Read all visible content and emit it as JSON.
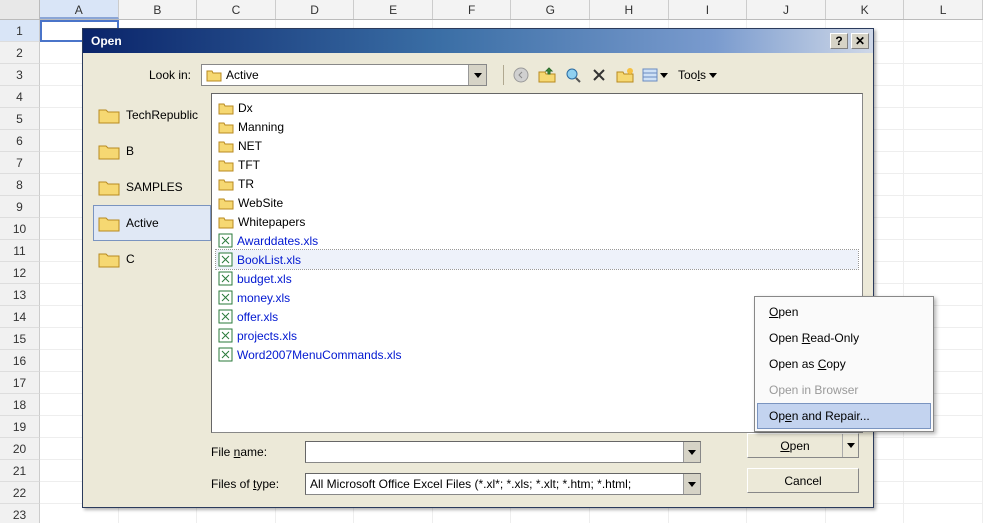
{
  "columns": [
    "A",
    "B",
    "C",
    "D",
    "E",
    "F",
    "G",
    "H",
    "I",
    "J",
    "K",
    "L"
  ],
  "row_count": 23,
  "selected_cell": {
    "row": 1,
    "col": "A"
  },
  "dialog": {
    "title": "Open",
    "lookin_label": "Look in:",
    "lookin_value": "Active",
    "tools_label": "Tools",
    "places": [
      {
        "label": "TechRepublic",
        "sel": false
      },
      {
        "label": "B",
        "sel": false
      },
      {
        "label": "SAMPLES",
        "sel": false
      },
      {
        "label": "Active",
        "sel": true
      },
      {
        "label": "C",
        "sel": false
      }
    ],
    "files": [
      {
        "name": "Dx",
        "type": "folder"
      },
      {
        "name": "Manning",
        "type": "folder"
      },
      {
        "name": "NET",
        "type": "folder"
      },
      {
        "name": "TFT",
        "type": "folder"
      },
      {
        "name": "TR",
        "type": "folder"
      },
      {
        "name": "WebSite",
        "type": "folder"
      },
      {
        "name": "Whitepapers",
        "type": "folder"
      },
      {
        "name": "Awarddates.xls",
        "type": "xls"
      },
      {
        "name": "BookList.xls",
        "type": "xls",
        "sel": true
      },
      {
        "name": "budget.xls",
        "type": "xls"
      },
      {
        "name": "money.xls",
        "type": "xls"
      },
      {
        "name": "offer.xls",
        "type": "xls"
      },
      {
        "name": "projects.xls",
        "type": "xls"
      },
      {
        "name": "Word2007MenuCommands.xls",
        "type": "xls"
      }
    ],
    "filename_label": "File name:",
    "filename_value": "",
    "filetype_label": "Files of type:",
    "filetype_value": "All Microsoft Office Excel Files (*.xl*; *.xls; *.xlt; *.htm; *.html;",
    "open_btn": "Open",
    "cancel_btn": "Cancel"
  },
  "context_menu": {
    "items": [
      {
        "label": "Open",
        "disabled": false,
        "hl": false,
        "accel": "O"
      },
      {
        "label": "Open Read-Only",
        "disabled": false,
        "hl": false,
        "accel": "R"
      },
      {
        "label": "Open as Copy",
        "disabled": false,
        "hl": false,
        "accel": "C"
      },
      {
        "label": "Open in Browser",
        "disabled": true,
        "hl": false,
        "accel": "B"
      },
      {
        "label": "Open and Repair...",
        "disabled": false,
        "hl": true,
        "accel": "E"
      }
    ]
  }
}
